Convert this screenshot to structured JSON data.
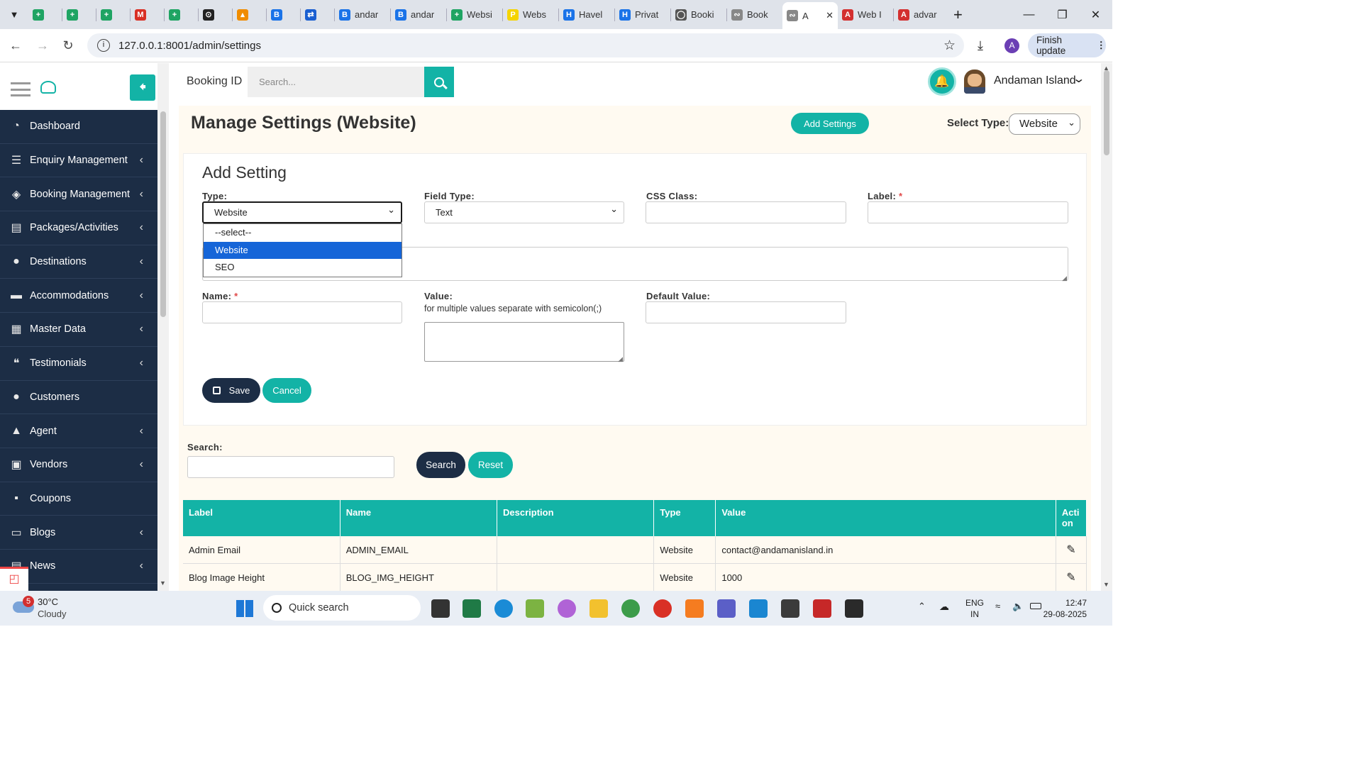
{
  "browser": {
    "tabs": [
      {
        "label": "",
        "icon": "sheets-icon",
        "color": "#1fa463"
      },
      {
        "label": "",
        "icon": "sheets-icon",
        "color": "#1fa463"
      },
      {
        "label": "",
        "icon": "sheets-icon",
        "color": "#1fa463"
      },
      {
        "label": "",
        "icon": "gmail-icon",
        "color": "#d93025"
      },
      {
        "label": "",
        "icon": "sheets-icon",
        "color": "#1fa463"
      },
      {
        "label": "",
        "icon": "openai-icon",
        "color": "#222222"
      },
      {
        "label": "",
        "icon": "phpmyadmin-icon",
        "color": "#f08c00"
      },
      {
        "label": "",
        "icon": "bootstrap-icon",
        "color": "#1a73e8"
      },
      {
        "label": "",
        "icon": "app-icon",
        "color": "#1a5fd1"
      },
      {
        "label": "andar",
        "icon": "bootstrap-icon",
        "color": "#1a73e8"
      },
      {
        "label": "andar",
        "icon": "bootstrap-icon",
        "color": "#1a73e8"
      },
      {
        "label": "Websi",
        "icon": "sheets-icon",
        "color": "#1fa463"
      },
      {
        "label": "Webs",
        "icon": "p-icon",
        "color": "#f5d400"
      },
      {
        "label": "Havel",
        "icon": "h-icon",
        "color": "#1a73e8"
      },
      {
        "label": "Privat",
        "icon": "h-icon",
        "color": "#1a73e8"
      },
      {
        "label": "Booki",
        "icon": "globe-icon",
        "color": "#555555"
      },
      {
        "label": "Book",
        "icon": "site-icon",
        "color": "#888888"
      },
      {
        "label": "A",
        "icon": "site-icon",
        "color": "#888888",
        "active": true
      },
      {
        "label": "Web I",
        "icon": "pdf-icon",
        "color": "#d32f2f"
      },
      {
        "label": "advar",
        "icon": "pdf-icon",
        "color": "#d32f2f"
      }
    ],
    "url": "127.0.0.1:8001/admin/settings",
    "finish_update": "Finish update",
    "profile_initial": "A"
  },
  "sidebar": {
    "items": [
      {
        "label": "Dashboard",
        "icon": "dashboard-icon",
        "chev": false
      },
      {
        "label": "Enquiry Management",
        "icon": "list-icon",
        "chev": true
      },
      {
        "label": "Booking Management",
        "icon": "ticket-icon",
        "chev": true
      },
      {
        "label": "Packages/Activities",
        "icon": "list-alt-icon",
        "chev": true
      },
      {
        "label": "Destinations",
        "icon": "map-marker-icon",
        "chev": true
      },
      {
        "label": "Accommodations",
        "icon": "bed-icon",
        "chev": true
      },
      {
        "label": "Master Data",
        "icon": "table-icon",
        "chev": true
      },
      {
        "label": "Testimonials",
        "icon": "quote-icon",
        "chev": true
      },
      {
        "label": "Customers",
        "icon": "users-icon",
        "chev": false
      },
      {
        "label": "Agent",
        "icon": "user-tie-icon",
        "chev": true
      },
      {
        "label": "Vendors",
        "icon": "briefcase-icon",
        "chev": true
      },
      {
        "label": "Coupons",
        "icon": "gift-icon",
        "chev": false
      },
      {
        "label": "Blogs",
        "icon": "book-icon",
        "chev": true
      },
      {
        "label": "News",
        "icon": "newspaper-icon",
        "chev": true
      }
    ]
  },
  "topbar": {
    "booking_label": "Booking ID",
    "search_placeholder": "Search...",
    "user_name": "Andaman Island"
  },
  "page": {
    "title": "Manage Settings (Website)",
    "add_settings": "Add Settings",
    "select_type_label": "Select Type:",
    "select_type_value": "Website"
  },
  "form": {
    "heading": "Add Setting",
    "type_label": "Type:",
    "type_value": "Website",
    "type_options": [
      "--select--",
      "Website",
      "SEO"
    ],
    "field_type_label": "Field Type:",
    "field_type_value": "Text",
    "css_label": "CSS Class:",
    "label_label": "Label:",
    "name_label": "Name:",
    "value_label": "Value:",
    "value_hint": "for multiple values separate with semicolon(;)",
    "default_label": "Default Value:",
    "save": "Save",
    "cancel": "Cancel",
    "required_mark": "*"
  },
  "search": {
    "label": "Search:",
    "search_btn": "Search",
    "reset_btn": "Reset"
  },
  "table": {
    "headers": [
      "Label",
      "Name",
      "Description",
      "Type",
      "Value",
      "Acti on"
    ],
    "rows": [
      [
        "Admin Email",
        "ADMIN_EMAIL",
        "",
        "Website",
        "contact@andamanisland.in"
      ],
      [
        "Blog Image Height",
        "BLOG_IMG_HEIGHT",
        "",
        "Website",
        "1000"
      ]
    ]
  },
  "taskbar": {
    "temp": "30°C",
    "weather": "Cloudy",
    "badge": "5",
    "search": "Quick search",
    "lang1": "ENG",
    "lang2": "IN",
    "time": "12:47",
    "date": "29-08-2025"
  },
  "colors": {
    "teal": "#13b3a6",
    "navy": "#1c2d45",
    "cream": "#fffaf1"
  }
}
